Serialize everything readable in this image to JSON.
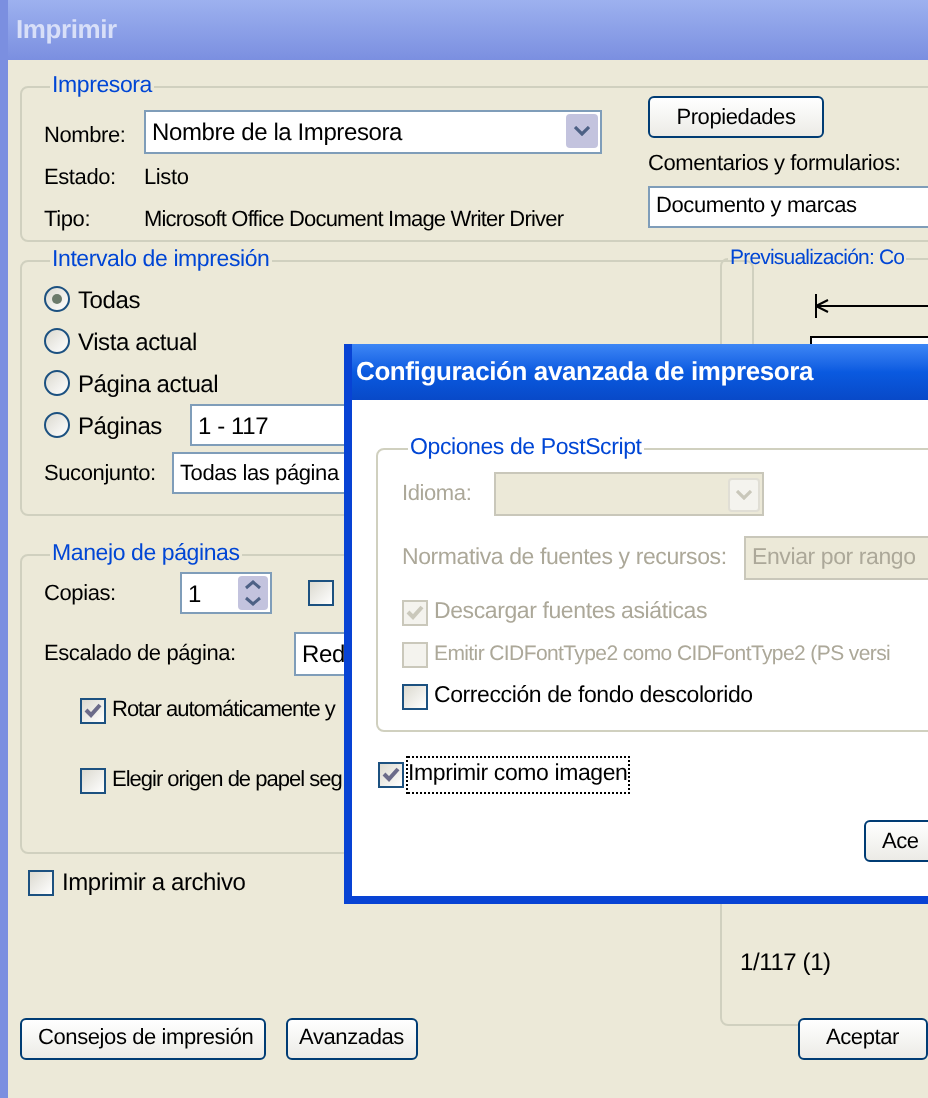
{
  "window": {
    "title": "Imprimir"
  },
  "printer": {
    "title": "Impresora",
    "name_label": "Nombre:",
    "name_value": "Nombre de la Impresora",
    "status_label": "Estado:",
    "status_value": "Listo",
    "type_label": "Tipo:",
    "type_value": "Microsoft Office Document Image Writer Driver",
    "properties_button": "Propiedades",
    "comments_label": "Comentarios y formularios:",
    "comments_value": "Documento y marcas"
  },
  "print_range": {
    "title": "Intervalo de impresión",
    "options": [
      {
        "label": "Todas",
        "selected": true
      },
      {
        "label": "Vista actual",
        "selected": false
      },
      {
        "label": "Página actual",
        "selected": false
      },
      {
        "label": "Páginas",
        "selected": false
      }
    ],
    "pages_value": "1 - 117",
    "subset_label": "Suconjunto:",
    "subset_value": "Todas las página"
  },
  "preview": {
    "title": "Previsualización: Co",
    "page_count": "1/117 (1)"
  },
  "page_handling": {
    "title": "Manejo de páginas",
    "copies_label": "Copias:",
    "copies_value": "1",
    "collate_checked": false,
    "scaling_label": "Escalado de página:",
    "scaling_value": "Red",
    "options": [
      {
        "label": "Rotar automáticamente y",
        "checked": true
      },
      {
        "label": "Elegir origen de papel seg",
        "checked": false
      }
    ]
  },
  "print_to_file": {
    "label": "Imprimir a archivo",
    "checked": false
  },
  "tips_button": "Consejos de impresión",
  "advanced_button": "Avanzadas",
  "ok_button": "Aceptar",
  "advanced_dialog": {
    "title": "Configuración avanzada de impresora",
    "group_title": "Opciones de PostScript",
    "language_label": "Idioma:",
    "font_policy_label": "Normativa de fuentes y recursos:",
    "font_policy_value": "Enviar por rango",
    "options": [
      {
        "label": "Descargar fuentes asiáticas",
        "checked": true,
        "disabled": true
      },
      {
        "label": "Emitir CIDFontType2 como CIDFontType2 (PS versi",
        "checked": false,
        "disabled": true
      },
      {
        "label": "Corrección de fondo descolorido",
        "checked": false,
        "disabled": false
      }
    ],
    "print_as_image": {
      "label": "Imprimir como imagen",
      "checked": true
    },
    "ok_button": "Ace"
  }
}
